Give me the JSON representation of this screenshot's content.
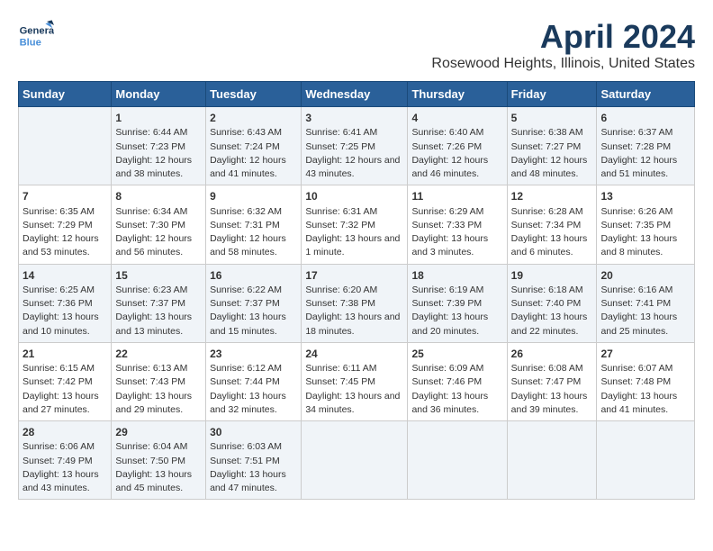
{
  "header": {
    "logo_general": "General",
    "logo_blue": "Blue",
    "title": "April 2024",
    "subtitle": "Rosewood Heights, Illinois, United States"
  },
  "days_of_week": [
    "Sunday",
    "Monday",
    "Tuesday",
    "Wednesday",
    "Thursday",
    "Friday",
    "Saturday"
  ],
  "weeks": [
    [
      {
        "day": "",
        "sunrise": "",
        "sunset": "",
        "daylight": ""
      },
      {
        "day": "1",
        "sunrise": "Sunrise: 6:44 AM",
        "sunset": "Sunset: 7:23 PM",
        "daylight": "Daylight: 12 hours and 38 minutes."
      },
      {
        "day": "2",
        "sunrise": "Sunrise: 6:43 AM",
        "sunset": "Sunset: 7:24 PM",
        "daylight": "Daylight: 12 hours and 41 minutes."
      },
      {
        "day": "3",
        "sunrise": "Sunrise: 6:41 AM",
        "sunset": "Sunset: 7:25 PM",
        "daylight": "Daylight: 12 hours and 43 minutes."
      },
      {
        "day": "4",
        "sunrise": "Sunrise: 6:40 AM",
        "sunset": "Sunset: 7:26 PM",
        "daylight": "Daylight: 12 hours and 46 minutes."
      },
      {
        "day": "5",
        "sunrise": "Sunrise: 6:38 AM",
        "sunset": "Sunset: 7:27 PM",
        "daylight": "Daylight: 12 hours and 48 minutes."
      },
      {
        "day": "6",
        "sunrise": "Sunrise: 6:37 AM",
        "sunset": "Sunset: 7:28 PM",
        "daylight": "Daylight: 12 hours and 51 minutes."
      }
    ],
    [
      {
        "day": "7",
        "sunrise": "Sunrise: 6:35 AM",
        "sunset": "Sunset: 7:29 PM",
        "daylight": "Daylight: 12 hours and 53 minutes."
      },
      {
        "day": "8",
        "sunrise": "Sunrise: 6:34 AM",
        "sunset": "Sunset: 7:30 PM",
        "daylight": "Daylight: 12 hours and 56 minutes."
      },
      {
        "day": "9",
        "sunrise": "Sunrise: 6:32 AM",
        "sunset": "Sunset: 7:31 PM",
        "daylight": "Daylight: 12 hours and 58 minutes."
      },
      {
        "day": "10",
        "sunrise": "Sunrise: 6:31 AM",
        "sunset": "Sunset: 7:32 PM",
        "daylight": "Daylight: 13 hours and 1 minute."
      },
      {
        "day": "11",
        "sunrise": "Sunrise: 6:29 AM",
        "sunset": "Sunset: 7:33 PM",
        "daylight": "Daylight: 13 hours and 3 minutes."
      },
      {
        "day": "12",
        "sunrise": "Sunrise: 6:28 AM",
        "sunset": "Sunset: 7:34 PM",
        "daylight": "Daylight: 13 hours and 6 minutes."
      },
      {
        "day": "13",
        "sunrise": "Sunrise: 6:26 AM",
        "sunset": "Sunset: 7:35 PM",
        "daylight": "Daylight: 13 hours and 8 minutes."
      }
    ],
    [
      {
        "day": "14",
        "sunrise": "Sunrise: 6:25 AM",
        "sunset": "Sunset: 7:36 PM",
        "daylight": "Daylight: 13 hours and 10 minutes."
      },
      {
        "day": "15",
        "sunrise": "Sunrise: 6:23 AM",
        "sunset": "Sunset: 7:37 PM",
        "daylight": "Daylight: 13 hours and 13 minutes."
      },
      {
        "day": "16",
        "sunrise": "Sunrise: 6:22 AM",
        "sunset": "Sunset: 7:37 PM",
        "daylight": "Daylight: 13 hours and 15 minutes."
      },
      {
        "day": "17",
        "sunrise": "Sunrise: 6:20 AM",
        "sunset": "Sunset: 7:38 PM",
        "daylight": "Daylight: 13 hours and 18 minutes."
      },
      {
        "day": "18",
        "sunrise": "Sunrise: 6:19 AM",
        "sunset": "Sunset: 7:39 PM",
        "daylight": "Daylight: 13 hours and 20 minutes."
      },
      {
        "day": "19",
        "sunrise": "Sunrise: 6:18 AM",
        "sunset": "Sunset: 7:40 PM",
        "daylight": "Daylight: 13 hours and 22 minutes."
      },
      {
        "day": "20",
        "sunrise": "Sunrise: 6:16 AM",
        "sunset": "Sunset: 7:41 PM",
        "daylight": "Daylight: 13 hours and 25 minutes."
      }
    ],
    [
      {
        "day": "21",
        "sunrise": "Sunrise: 6:15 AM",
        "sunset": "Sunset: 7:42 PM",
        "daylight": "Daylight: 13 hours and 27 minutes."
      },
      {
        "day": "22",
        "sunrise": "Sunrise: 6:13 AM",
        "sunset": "Sunset: 7:43 PM",
        "daylight": "Daylight: 13 hours and 29 minutes."
      },
      {
        "day": "23",
        "sunrise": "Sunrise: 6:12 AM",
        "sunset": "Sunset: 7:44 PM",
        "daylight": "Daylight: 13 hours and 32 minutes."
      },
      {
        "day": "24",
        "sunrise": "Sunrise: 6:11 AM",
        "sunset": "Sunset: 7:45 PM",
        "daylight": "Daylight: 13 hours and 34 minutes."
      },
      {
        "day": "25",
        "sunrise": "Sunrise: 6:09 AM",
        "sunset": "Sunset: 7:46 PM",
        "daylight": "Daylight: 13 hours and 36 minutes."
      },
      {
        "day": "26",
        "sunrise": "Sunrise: 6:08 AM",
        "sunset": "Sunset: 7:47 PM",
        "daylight": "Daylight: 13 hours and 39 minutes."
      },
      {
        "day": "27",
        "sunrise": "Sunrise: 6:07 AM",
        "sunset": "Sunset: 7:48 PM",
        "daylight": "Daylight: 13 hours and 41 minutes."
      }
    ],
    [
      {
        "day": "28",
        "sunrise": "Sunrise: 6:06 AM",
        "sunset": "Sunset: 7:49 PM",
        "daylight": "Daylight: 13 hours and 43 minutes."
      },
      {
        "day": "29",
        "sunrise": "Sunrise: 6:04 AM",
        "sunset": "Sunset: 7:50 PM",
        "daylight": "Daylight: 13 hours and 45 minutes."
      },
      {
        "day": "30",
        "sunrise": "Sunrise: 6:03 AM",
        "sunset": "Sunset: 7:51 PM",
        "daylight": "Daylight: 13 hours and 47 minutes."
      },
      {
        "day": "",
        "sunrise": "",
        "sunset": "",
        "daylight": ""
      },
      {
        "day": "",
        "sunrise": "",
        "sunset": "",
        "daylight": ""
      },
      {
        "day": "",
        "sunrise": "",
        "sunset": "",
        "daylight": ""
      },
      {
        "day": "",
        "sunrise": "",
        "sunset": "",
        "daylight": ""
      }
    ]
  ]
}
